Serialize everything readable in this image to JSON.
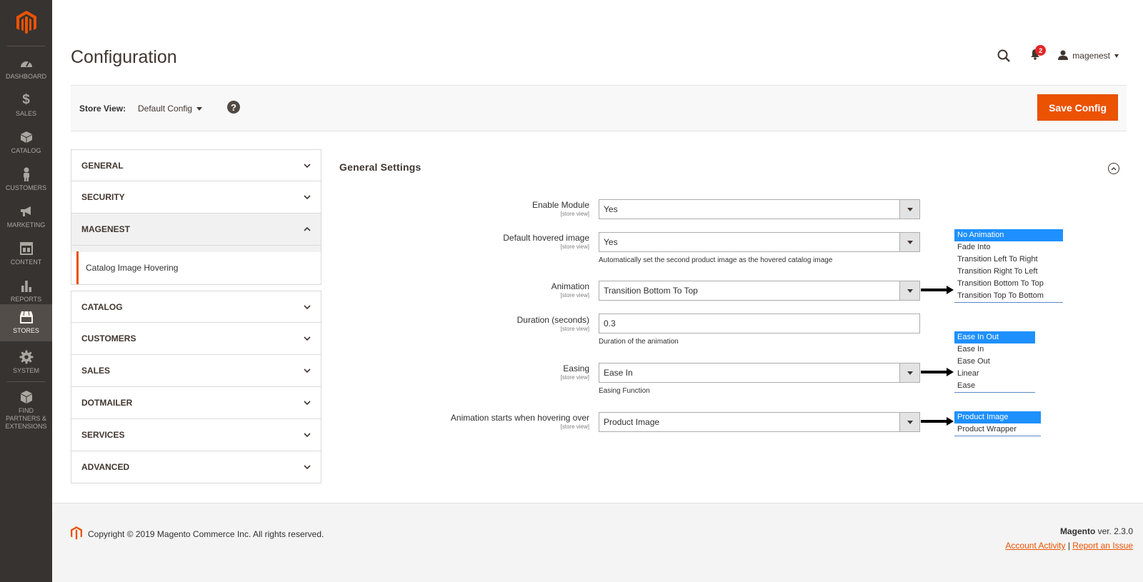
{
  "menu": {
    "items": [
      {
        "label": "Dashboard",
        "icon": "dashboard-icon"
      },
      {
        "label": "Sales",
        "icon": "dollar-icon"
      },
      {
        "label": "Catalog",
        "icon": "box-icon"
      },
      {
        "label": "Customers",
        "icon": "person-icon"
      },
      {
        "label": "Marketing",
        "icon": "megaphone-icon"
      },
      {
        "label": "Content",
        "icon": "layout-icon"
      },
      {
        "label": "Reports",
        "icon": "bar-chart-icon"
      },
      {
        "label": "Stores",
        "icon": "storefront-icon"
      },
      {
        "label": "System",
        "icon": "gear-icon"
      },
      {
        "label": "Find Partners & Extensions",
        "icon": "cube-icon"
      }
    ],
    "active": "Stores"
  },
  "header": {
    "title": "Configuration",
    "notifications_count": "2",
    "username": "magenest"
  },
  "store_bar": {
    "label": "Store View:",
    "value": "Default Config",
    "help": "?",
    "save_label": "Save Config"
  },
  "tabs": {
    "general": "GENERAL",
    "security": "SECURITY",
    "magenest": "MAGENEST",
    "magenest_sub": "Catalog Image Hovering",
    "catalog": "CATALOG",
    "customers": "CUSTOMERS",
    "sales": "SALES",
    "dotmailer": "DOTMAILER",
    "services": "SERVICES",
    "advanced": "ADVANCED"
  },
  "section": {
    "title": "General Settings",
    "scope": "[store view]",
    "fields": {
      "enable_module": {
        "label": "Enable Module",
        "value": "Yes"
      },
      "default_hovered": {
        "label": "Default hovered image",
        "value": "Yes",
        "note": "Automatically set the second product image as the hovered catalog image"
      },
      "animation": {
        "label": "Animation",
        "value": "Transition Bottom To Top"
      },
      "duration": {
        "label": "Duration (seconds)",
        "value": "0.3",
        "note": "Duration of the animation"
      },
      "easing": {
        "label": "Easing",
        "value": "Ease In",
        "note": "Easing Function"
      },
      "hover_target": {
        "label": "Animation starts when hovering over",
        "value": "Product Image"
      }
    }
  },
  "listboxes": {
    "animation": [
      "No Animation",
      "Fade Into",
      "Transition Left To Right",
      "Transition Right To Left",
      "Transition Bottom To Top",
      "Transition Top To Bottom"
    ],
    "easing": [
      "Ease In Out",
      "Ease In",
      "Ease Out",
      "Linear",
      "Ease"
    ],
    "hover_target": [
      "Product Image",
      "Product Wrapper"
    ]
  },
  "footer": {
    "copyright": "Copyright © 2019 Magento Commerce Inc. All rights reserved.",
    "brand": "Magento",
    "version": "ver. 2.3.0",
    "link_activity": "Account Activity",
    "link_sep": "|",
    "link_issue": "Report an Issue"
  },
  "colors": {
    "accent": "#eb5202",
    "menu_bg": "#373330",
    "selected_option": "#1e90ff"
  }
}
